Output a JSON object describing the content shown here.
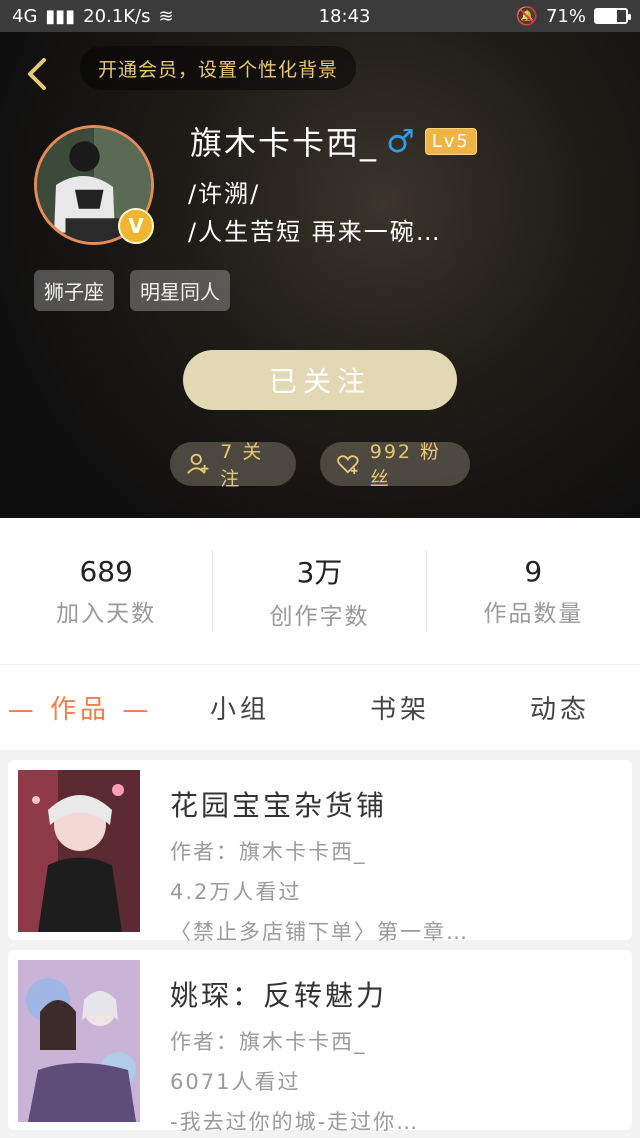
{
  "status_bar": {
    "network": "4G",
    "speed": "20.1K/s",
    "time": "18:43",
    "battery_percent": "71%",
    "battery_level": 0.71
  },
  "header": {
    "back_icon": "chevron-left-icon",
    "vip_banner": "开通会员，设置个性化背景",
    "name": "旗木卡卡西_",
    "gender_symbol": "♂",
    "level": "Lv5",
    "bio_line1": "/许溯/",
    "bio_line2": "/人生苦短 再来一碗…",
    "verified_badge": "V",
    "tags": [
      "狮子座",
      "明星同人"
    ],
    "follow_button": "已关注",
    "following_count": "7 关注",
    "fans_count": "992 粉丝"
  },
  "stats": [
    {
      "value": "689",
      "label": "加入天数"
    },
    {
      "value": "3万",
      "label": "创作字数"
    },
    {
      "value": "9",
      "label": "作品数量"
    }
  ],
  "tabs": [
    {
      "label": "— 作品 —",
      "active": true
    },
    {
      "label": "小组",
      "active": false
    },
    {
      "label": "书架",
      "active": false
    },
    {
      "label": "动态",
      "active": false
    }
  ],
  "works": [
    {
      "title": "花园宝宝杂货铺",
      "author": "作者：旗木卡卡西_",
      "views": "4.2万人看过",
      "excerpt": "〈禁止多店铺下单〉第一章…"
    },
    {
      "title": "姚琛：反转魅力",
      "author": "作者：旗木卡卡西_",
      "views": "6071人看过",
      "excerpt": "-我去过你的城-走过你…"
    }
  ],
  "colors": {
    "accent_gold": "#e7c873",
    "active_tab": "#f17f4d",
    "follow_button_bg": "#e3d8b4",
    "level_badge": "#f0b444"
  }
}
